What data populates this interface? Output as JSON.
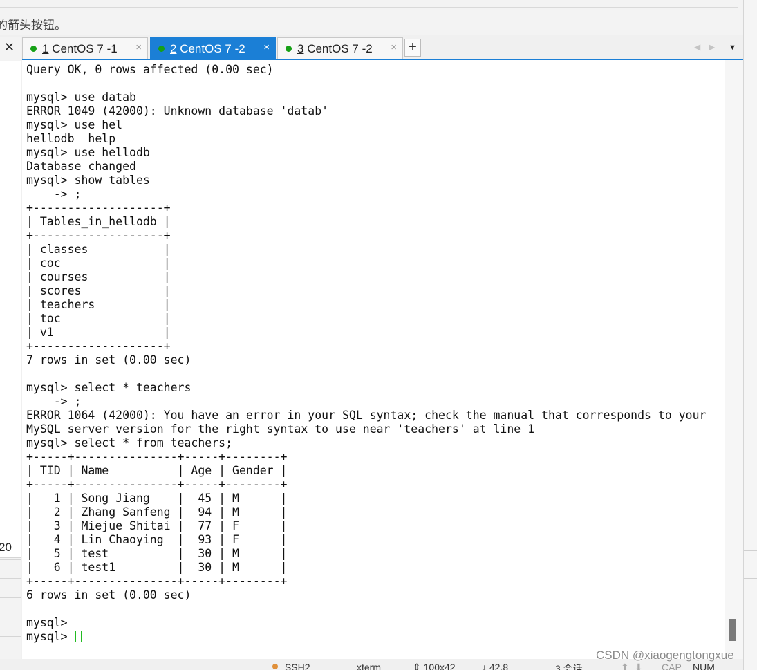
{
  "top_hint_text": "的箭头按钮。",
  "tabs": [
    {
      "num": "1",
      "title": " CentOS 7 -1",
      "active": false
    },
    {
      "num": "2",
      "title": " CentOS 7 -2",
      "active": true
    },
    {
      "num": "3",
      "title": " CentOS 7 -2",
      "active": false
    }
  ],
  "tab_close_symbol": "×",
  "close_symbol": "✕",
  "add_tab_symbol": "+",
  "nav_prev": "◀",
  "nav_next": "▶",
  "menu_symbol": "▼",
  "left_number": "20",
  "terminal": {
    "lines": [
      "Query OK, 0 rows affected (0.00 sec)",
      "",
      "mysql> use datab",
      "ERROR 1049 (42000): Unknown database 'datab'",
      "mysql> use hel",
      "hellodb  help",
      "mysql> use hellodb",
      "Database changed",
      "mysql> show tables",
      "    -> ;",
      "+-------------------+",
      "| Tables_in_hellodb |",
      "+-------------------+",
      "| classes           |",
      "| coc               |",
      "| courses           |",
      "| scores            |",
      "| teachers          |",
      "| toc               |",
      "| v1                |",
      "+-------------------+",
      "7 rows in set (0.00 sec)",
      "",
      "mysql> select * teachers",
      "    -> ;",
      "ERROR 1064 (42000): You have an error in your SQL syntax; check the manual that corresponds to your",
      "MySQL server version for the right syntax to use near 'teachers' at line 1",
      "mysql> select * from teachers;",
      "+-----+---------------+-----+--------+",
      "| TID | Name          | Age | Gender |",
      "+-----+---------------+-----+--------+",
      "|   1 | Song Jiang    |  45 | M      |",
      "|   2 | Zhang Sanfeng |  94 | M      |",
      "|   3 | Miejue Shitai |  77 | F      |",
      "|   4 | Lin Chaoying  |  93 | F      |",
      "|   5 | test          |  30 | M      |",
      "|   6 | test1         |  30 | M      |",
      "+-----+---------------+-----+--------+",
      "6 rows in set (0.00 sec)",
      "",
      "mysql>"
    ],
    "prompt": "mysql> "
  },
  "status": {
    "protocol": "SSH2",
    "terminal_type": "xterm",
    "size": "100x42",
    "position": "42,8",
    "sessions": "3 会话",
    "caps": "CAP",
    "num": "NUM"
  },
  "watermark": "CSDN @xiaogengtongxue",
  "colors": {
    "active_tab": "#1b7fd6",
    "status_dot": "#16a016",
    "cursor": "#22bb22"
  }
}
